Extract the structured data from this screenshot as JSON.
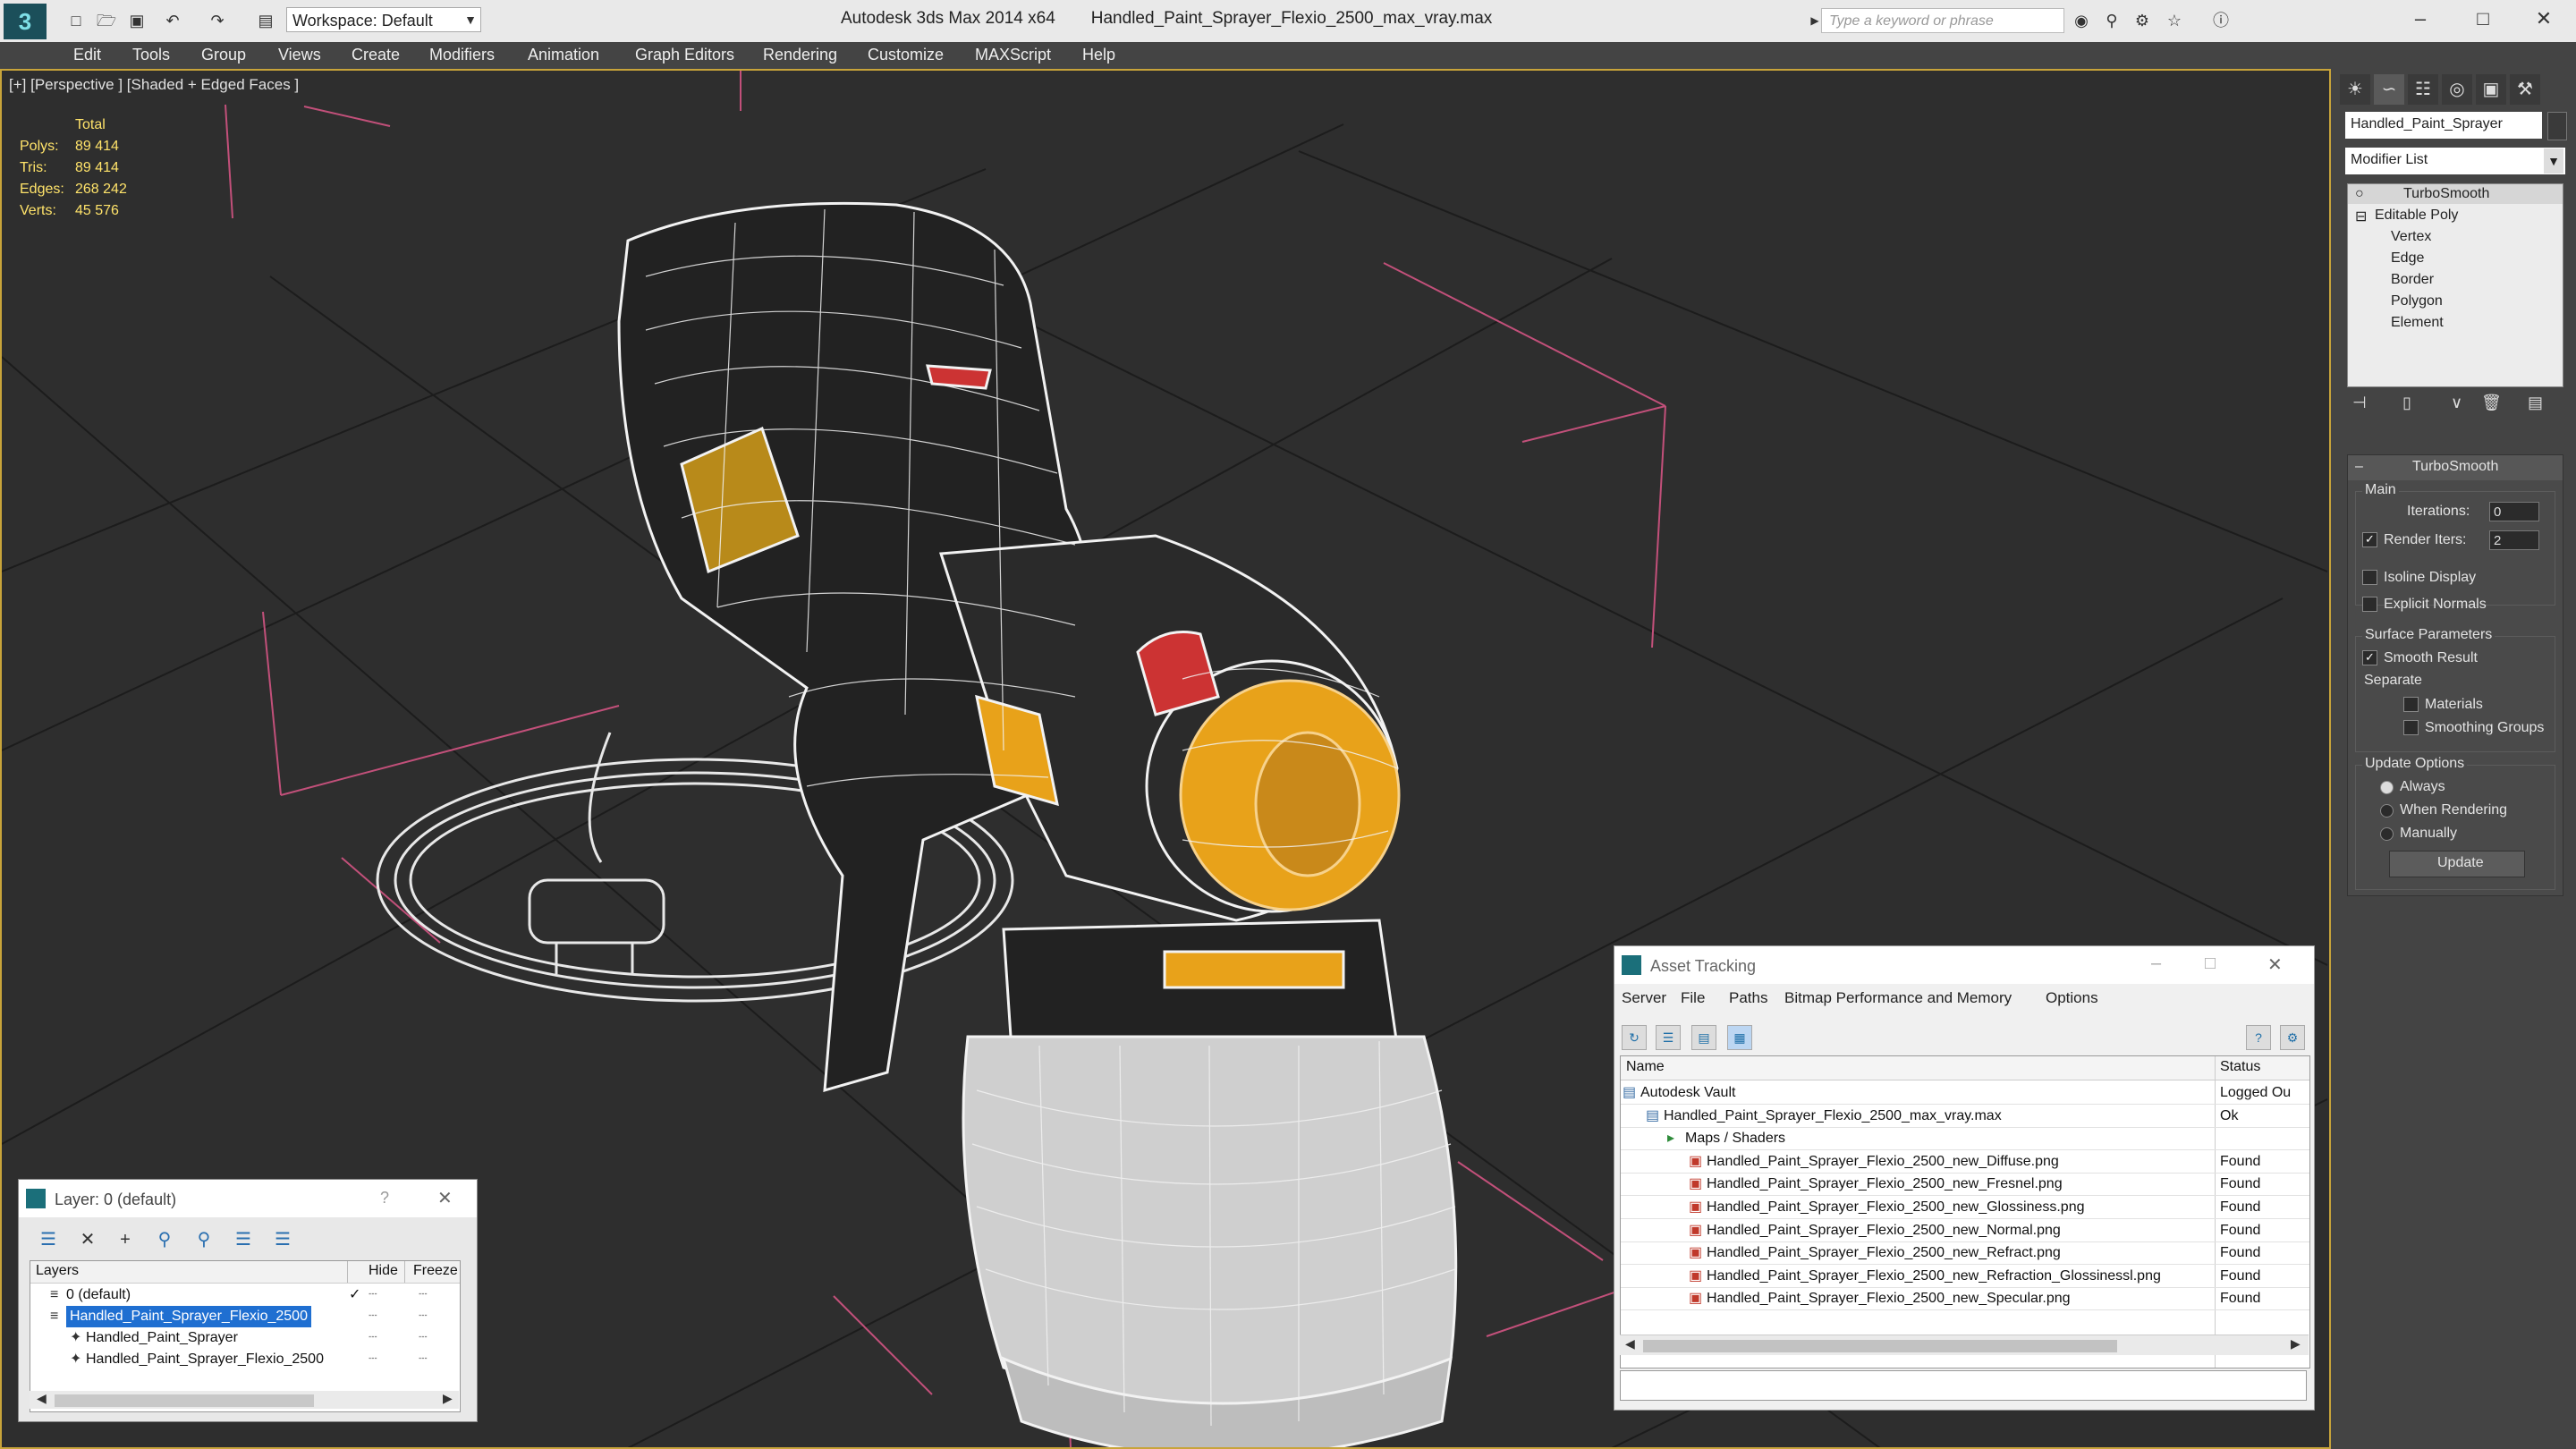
{
  "app": {
    "title": "Autodesk 3ds Max 2014 x64",
    "file": "Handled_Paint_Sprayer_Flexio_2500_max_vray.max",
    "workspace": "Workspace: Default",
    "search_placeholder": "Type a keyword or phrase"
  },
  "menu": [
    "Edit",
    "Tools",
    "Group",
    "Views",
    "Create",
    "Modifiers",
    "Animation",
    "Graph Editors",
    "Rendering",
    "Customize",
    "MAXScript",
    "Help"
  ],
  "viewport": {
    "label": "[+] [Perspective ] [Shaded + Edged Faces ]",
    "stats": {
      "header": "Total",
      "rows": [
        {
          "label": "Polys:",
          "value": "89 414"
        },
        {
          "label": "Tris:",
          "value": "89 414"
        },
        {
          "label": "Edges:",
          "value": "268 242"
        },
        {
          "label": "Verts:",
          "value": "45 576"
        }
      ]
    }
  },
  "command_panel": {
    "object_name": "Handled_Paint_Sprayer",
    "modifier_list": "Modifier List",
    "stack": [
      "TurboSmooth",
      "Editable Poly",
      "Vertex",
      "Edge",
      "Border",
      "Polygon",
      "Element"
    ],
    "turbosmooth": {
      "title": "TurboSmooth",
      "main": "Main",
      "iterations_label": "Iterations:",
      "iterations": "0",
      "render_iters_label": "Render Iters:",
      "render_iters": "2",
      "isoline": "Isoline Display",
      "explicit_normals": "Explicit Normals",
      "surface_params": "Surface Parameters",
      "smooth_result": "Smooth Result",
      "separate": "Separate",
      "materials": "Materials",
      "smoothing_groups": "Smoothing Groups",
      "update_options": "Update Options",
      "always": "Always",
      "when_rendering": "When Rendering",
      "manually": "Manually",
      "update": "Update"
    }
  },
  "asset_tracking": {
    "title": "Asset Tracking",
    "menu": [
      "Server",
      "File",
      "Paths",
      "Bitmap Performance and Memory",
      "Options"
    ],
    "columns": [
      "Name",
      "Status"
    ],
    "rows": [
      {
        "name": "Autodesk Vault",
        "status": "Logged Ou",
        "level": 0
      },
      {
        "name": "Handled_Paint_Sprayer_Flexio_2500_max_vray.max",
        "status": "Ok",
        "level": 1
      },
      {
        "name": "Maps / Shaders",
        "status": "",
        "level": 2
      },
      {
        "name": "Handled_Paint_Sprayer_Flexio_2500_new_Diffuse.png",
        "status": "Found",
        "level": 3
      },
      {
        "name": "Handled_Paint_Sprayer_Flexio_2500_new_Fresnel.png",
        "status": "Found",
        "level": 3
      },
      {
        "name": "Handled_Paint_Sprayer_Flexio_2500_new_Glossiness.png",
        "status": "Found",
        "level": 3
      },
      {
        "name": "Handled_Paint_Sprayer_Flexio_2500_new_Normal.png",
        "status": "Found",
        "level": 3
      },
      {
        "name": "Handled_Paint_Sprayer_Flexio_2500_new_Refract.png",
        "status": "Found",
        "level": 3
      },
      {
        "name": "Handled_Paint_Sprayer_Flexio_2500_new_Refraction_Glossinessl.png",
        "status": "Found",
        "level": 3
      },
      {
        "name": "Handled_Paint_Sprayer_Flexio_2500_new_Specular.png",
        "status": "Found",
        "level": 3
      }
    ]
  },
  "layers": {
    "title": "Layer: 0 (default)",
    "help": "?",
    "columns": [
      "Layers",
      "Hide",
      "Freeze"
    ],
    "rows": [
      {
        "name": "0 (default)",
        "level": 0
      },
      {
        "name": "Handled_Paint_Sprayer_Flexio_2500",
        "level": 0,
        "selected": true
      },
      {
        "name": "Handled_Paint_Sprayer",
        "level": 1
      },
      {
        "name": "Handled_Paint_Sprayer_Flexio_2500",
        "level": 1
      }
    ]
  },
  "colors": {
    "accent_selection": "#1f6fd1",
    "viewport_border": "#c8a43a",
    "stats_text": "#ffe36a",
    "model_highlight": "#e8a21a"
  }
}
